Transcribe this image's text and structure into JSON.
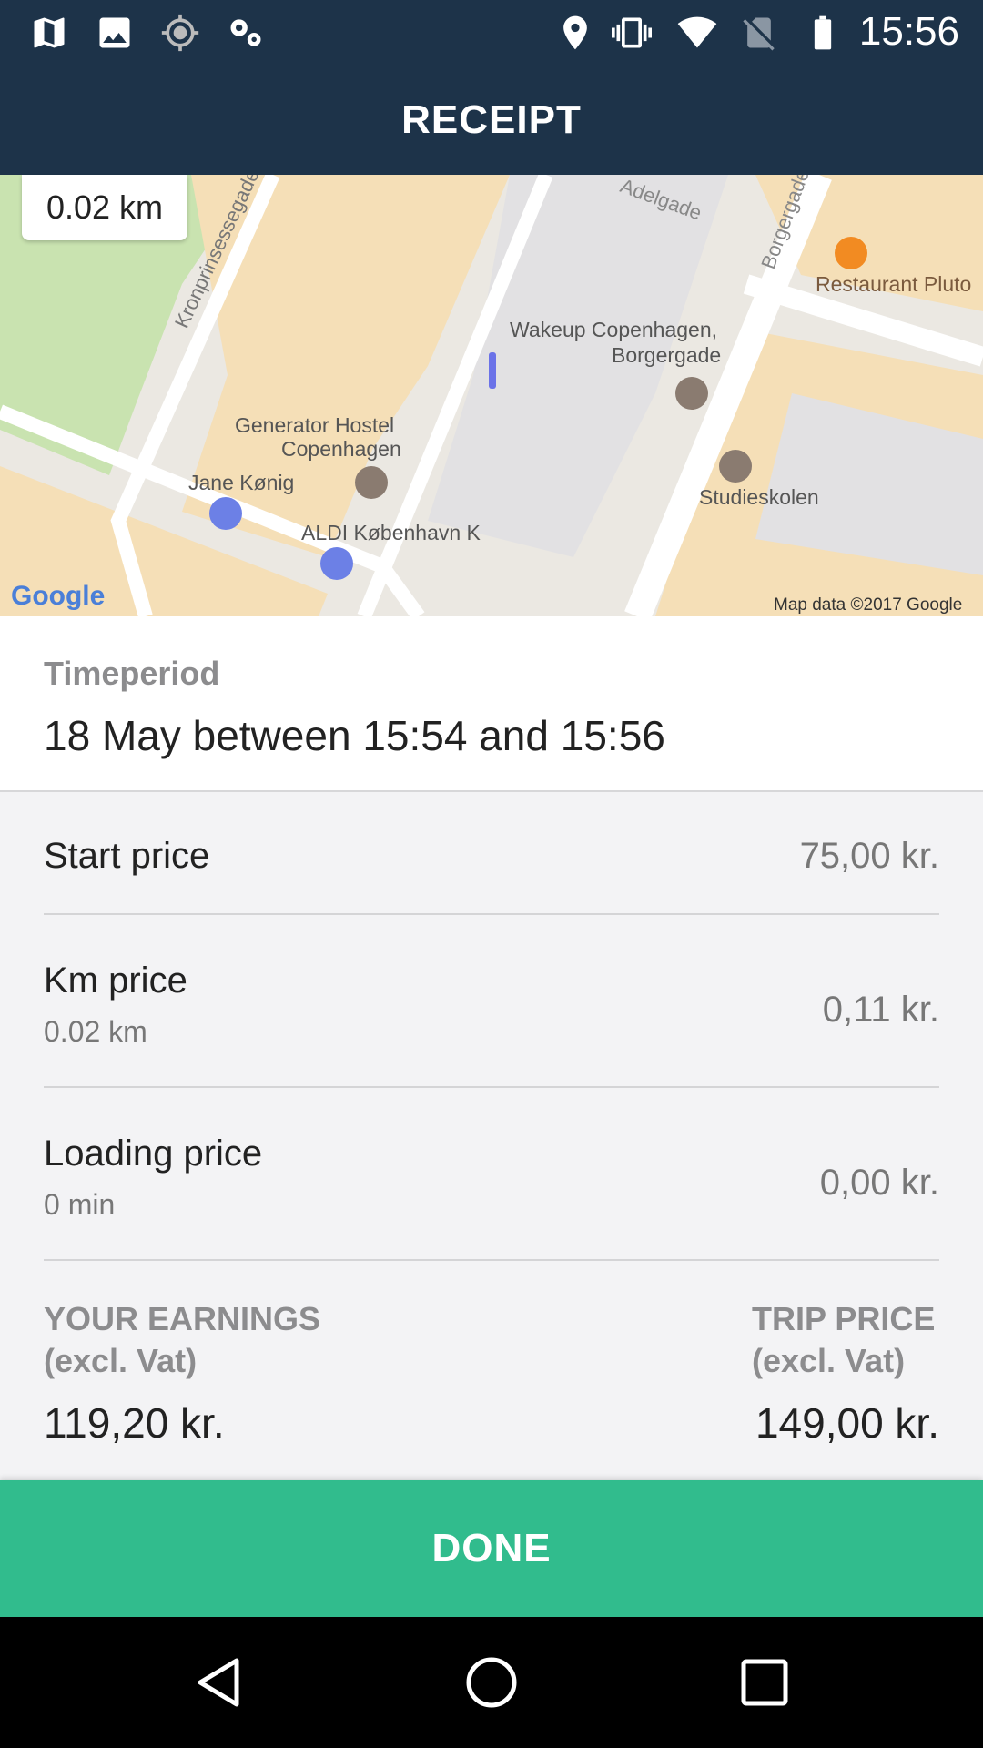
{
  "status_bar": {
    "time": "15:56",
    "left_icons": [
      "map-icon",
      "image-icon",
      "location-target-icon",
      "settings-cog-icon"
    ],
    "right_icons": [
      "location-pin-icon",
      "vibrate-icon",
      "wifi-icon",
      "no-sim-icon",
      "battery-icon"
    ]
  },
  "app_bar": {
    "title": "RECEIPT"
  },
  "map": {
    "distance": "0.02 km",
    "labels": {
      "street_kronprinsesse": "Kronprinsessegade",
      "street_adelgade": "Adelgade",
      "street_borgergade": "Borgergade",
      "restaurant": "Restaurant Pluto",
      "wakeup_line1": "Wakeup Copenhagen,",
      "wakeup_line2": "Borgergade",
      "generator_line1": "Generator Hostel",
      "generator_line2": "Copenhagen",
      "jane": "Jane Kønig",
      "studieskolen": "Studieskolen",
      "aldi": "ALDI København K",
      "google_logo": "Google",
      "attribution": "Map data ©2017 Google"
    }
  },
  "timeperiod": {
    "label": "Timeperiod",
    "value": "18 May between 15:54 and 15:56"
  },
  "prices": {
    "start": {
      "label": "Start price",
      "value": "75,00 kr."
    },
    "km": {
      "label": "Km price",
      "sub": "0.02 km",
      "value": "0,11 kr."
    },
    "loading": {
      "label": "Loading price",
      "sub": "0 min",
      "value": "0,00 kr."
    }
  },
  "earnings": {
    "your_label_line1": "YOUR EARNINGS",
    "your_label_line2": "(excl. Vat)",
    "your_value": "119,20 kr.",
    "trip_label_line1": "TRIP PRICE",
    "trip_label_line2": "(excl. Vat)",
    "trip_value": "149,00 kr."
  },
  "done_button": {
    "label": "DONE"
  },
  "colors": {
    "header": "#1d3349",
    "accent": "#31bc8d",
    "muted_text": "#8c8c8e"
  }
}
